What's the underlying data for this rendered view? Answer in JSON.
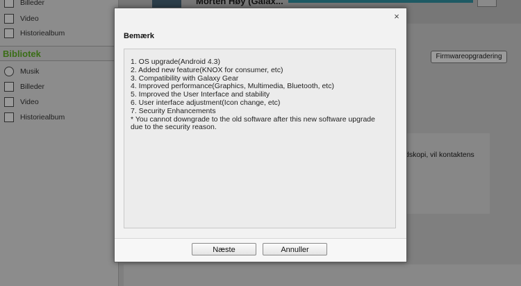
{
  "sidebar": {
    "top_items": [
      {
        "label": "Billeder",
        "icon": "image-icon"
      },
      {
        "label": "Video",
        "icon": "film-icon"
      },
      {
        "label": "Historiealbum",
        "icon": "book-icon"
      }
    ],
    "section_title": "Bibliotek",
    "library_items": [
      {
        "label": "Musik",
        "icon": "music-disc-icon"
      },
      {
        "label": "Billeder",
        "icon": "image-icon"
      },
      {
        "label": "Video",
        "icon": "film-icon"
      },
      {
        "label": "Historiealbum",
        "icon": "book-icon"
      }
    ]
  },
  "header": {
    "device_name": "Morten Høy (Galax..."
  },
  "main": {
    "firmware_button": "Firmwareopgradering",
    "info_lines": [
      "dskopi, vil kontaktens",
      "."
    ]
  },
  "dialog": {
    "title": "Bemærk",
    "close_symbol": "×",
    "lines": [
      "1. OS upgrade(Android 4.3)",
      "2. Added new feature(KNOX for consumer, etc)",
      "3. Compatibility with Galaxy Gear",
      "4. Improved performance(Graphics, Multimedia, Bluetooth, etc)",
      "5. Improved the User Interface and stability",
      "6. User interface adjustment(Icon change, etc)",
      "7. Security Enhancements",
      "* You cannot downgrade to the old software after this new software upgrade",
      "due to the security reason."
    ],
    "next_button": "Næste",
    "cancel_button": "Annuller"
  },
  "colors": {
    "overlay_dim": "#7d7d7d",
    "library_header": "#3a6d16",
    "dialog_bg": "#f2f2f2"
  }
}
